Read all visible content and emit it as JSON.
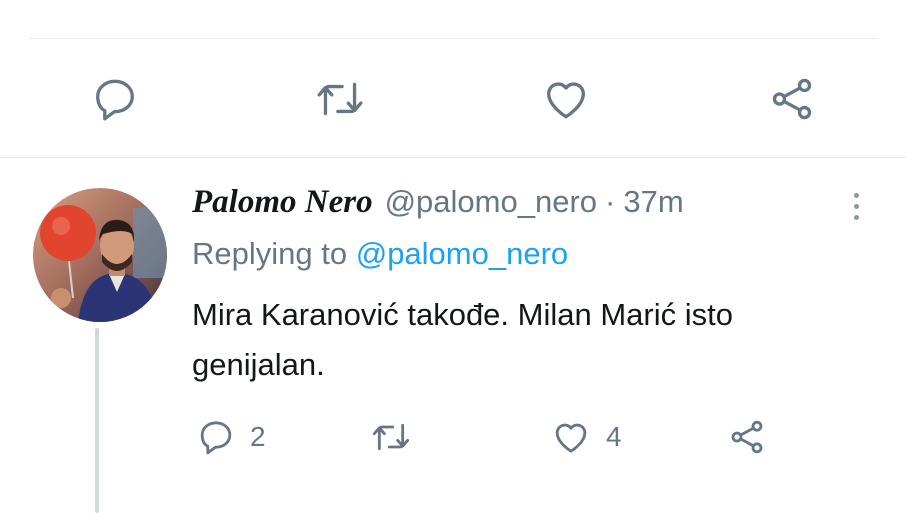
{
  "main_tweet_actions": {
    "reply_icon": "reply-icon",
    "retweet_icon": "retweet-icon",
    "like_icon": "like-icon",
    "share_icon": "share-icon"
  },
  "reply_tweet": {
    "display_name": "Palomo Nero",
    "handle": "@palomo_nero",
    "separator": "·",
    "time": "37m",
    "replying_prefix": "Replying to",
    "replying_to": "@palomo_nero",
    "text_line1": "Mira Karanović takođe. Milan Marić isto",
    "text_line2": "genijalan.",
    "reply_count": "2",
    "retweet_count": "",
    "like_count": "4",
    "more_icon": "more-vertical-icon"
  },
  "colors": {
    "accent": "#1da1f2",
    "text": "#14171a",
    "secondary": "#657786",
    "divider": "#e6ecf0"
  }
}
